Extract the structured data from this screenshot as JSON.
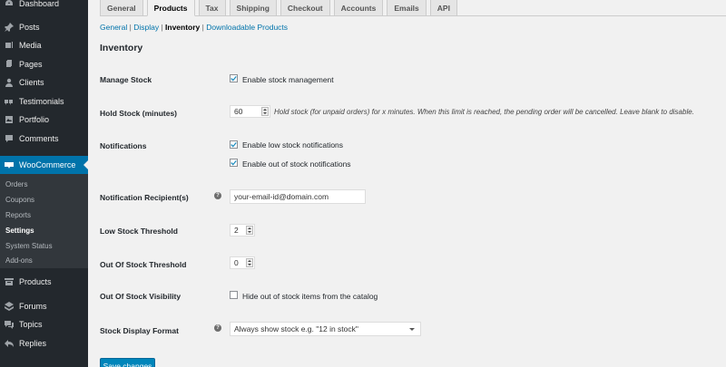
{
  "sidebar": {
    "items": [
      {
        "label": "Dashboard",
        "icon": "dashboard-icon"
      },
      {
        "label": "Posts",
        "icon": "pin-icon"
      },
      {
        "label": "Media",
        "icon": "media-icon"
      },
      {
        "label": "Pages",
        "icon": "pages-icon"
      },
      {
        "label": "Clients",
        "icon": "user-icon"
      },
      {
        "label": "Testimonials",
        "icon": "quote-icon"
      },
      {
        "label": "Portfolio",
        "icon": "portfolio-icon"
      },
      {
        "label": "Comments",
        "icon": "comment-icon"
      },
      {
        "label": "WooCommerce",
        "icon": "woo-icon"
      },
      {
        "label": "Products",
        "icon": "archive-icon"
      },
      {
        "label": "Forums",
        "icon": "forum-icon"
      },
      {
        "label": "Topics",
        "icon": "topic-icon"
      },
      {
        "label": "Replies",
        "icon": "reply-icon"
      }
    ],
    "submenu": [
      "Orders",
      "Coupons",
      "Reports",
      "Settings",
      "System Status",
      "Add-ons"
    ],
    "active_color": "#0073aa"
  },
  "tabs": [
    "General",
    "Products",
    "Tax",
    "Shipping",
    "Checkout",
    "Accounts",
    "Emails",
    "API"
  ],
  "active_tab": "Products",
  "subsections": {
    "general": "General",
    "display": "Display",
    "inventory": "Inventory",
    "downloadable": "Downloadable Products"
  },
  "section_title": "Inventory",
  "fields": {
    "manage_stock": {
      "label": "Manage Stock",
      "checkbox_label": "Enable stock management",
      "checked": true
    },
    "hold_stock": {
      "label": "Hold Stock (minutes)",
      "value": "60",
      "description": "Hold stock (for unpaid orders) for x minutes. When this limit is reached, the pending order will be cancelled. Leave blank to disable."
    },
    "notifications": {
      "label": "Notifications",
      "low_stock_label": "Enable low stock notifications",
      "low_stock_checked": true,
      "out_of_stock_label": "Enable out of stock notifications",
      "out_of_stock_checked": true
    },
    "recipient": {
      "label": "Notification Recipient(s)",
      "value": "your-email-id@domain.com"
    },
    "low_threshold": {
      "label": "Low Stock Threshold",
      "value": "2"
    },
    "out_threshold": {
      "label": "Out Of Stock Threshold",
      "value": "0"
    },
    "visibility": {
      "label": "Out Of Stock Visibility",
      "checkbox_label": "Hide out of stock items from the catalog",
      "checked": false
    },
    "display_format": {
      "label": "Stock Display Format",
      "value": "Always show stock e.g. \"12 in stock\""
    }
  },
  "help_glyph": "?",
  "save_label": "Save changes"
}
